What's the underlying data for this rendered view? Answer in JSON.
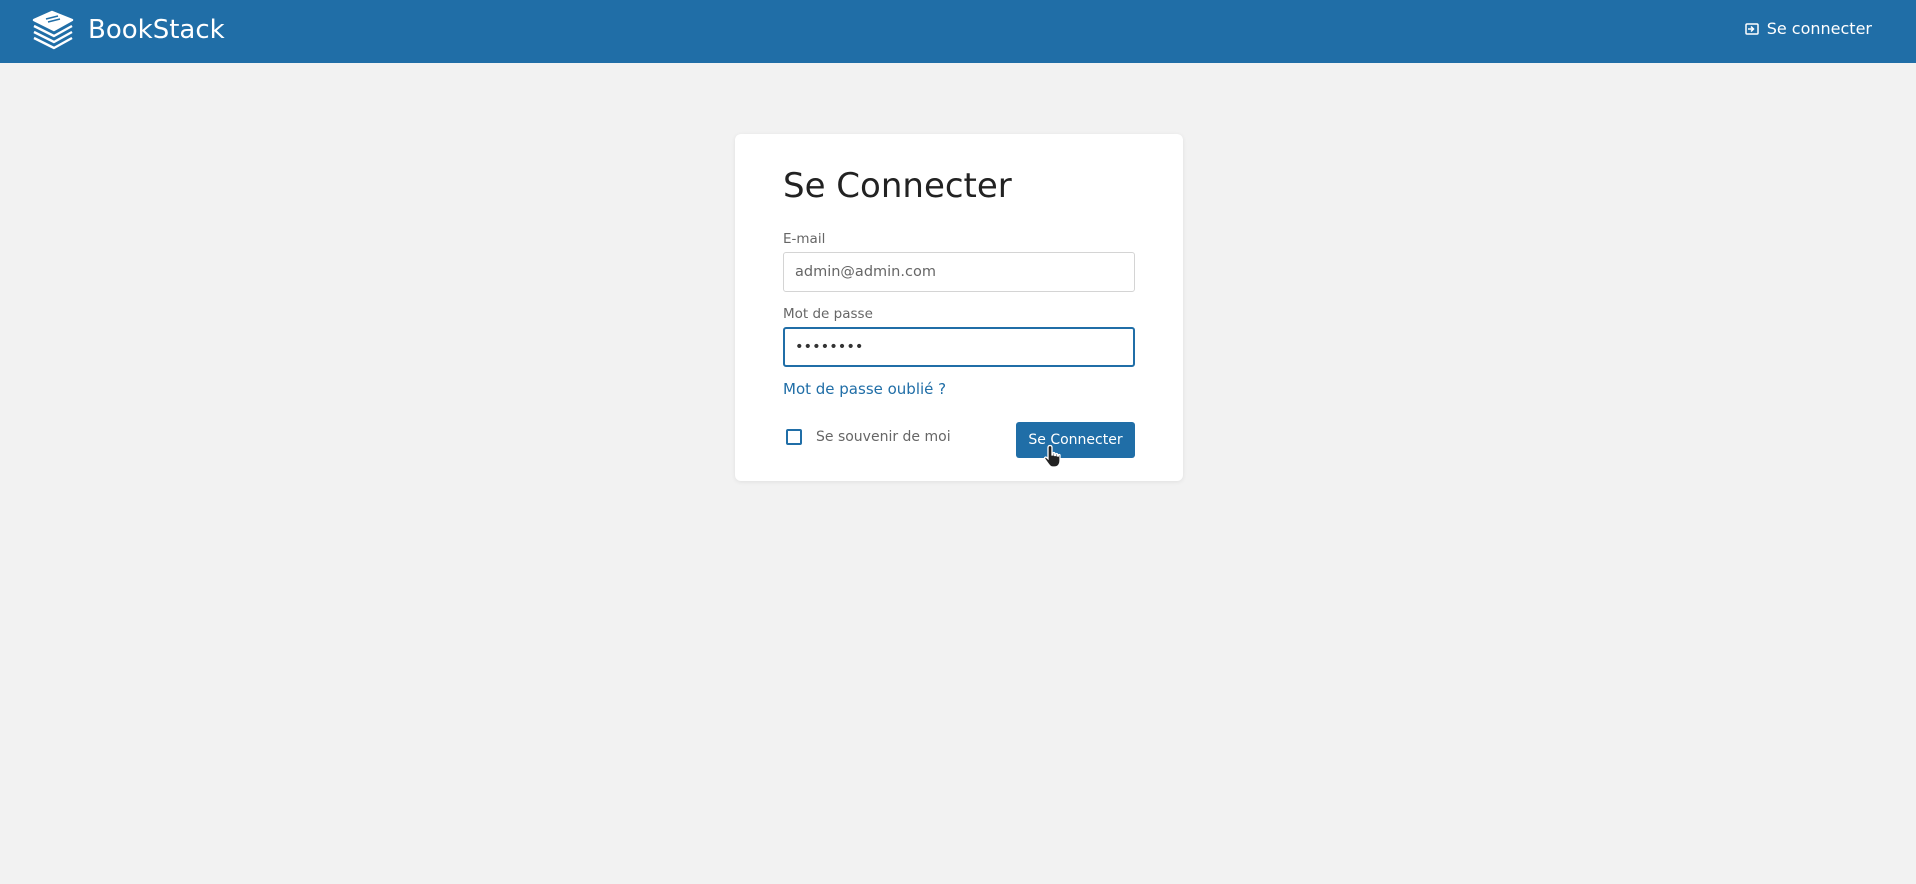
{
  "header": {
    "brand": "BookStack",
    "login_link": "Se connecter",
    "logo_icon": "bookstack-logo-icon",
    "login_icon": "login-icon",
    "bg_color": "#206ea7"
  },
  "login_form": {
    "title": "Se Connecter",
    "email_label": "E-mail",
    "email_value": "admin@admin.com",
    "password_label": "Mot de passe",
    "password_value": "••••••••",
    "forgot_password": "Mot de passe oublié ?",
    "remember_me": "Se souvenir de moi",
    "submit_label": "Se Connecter"
  }
}
